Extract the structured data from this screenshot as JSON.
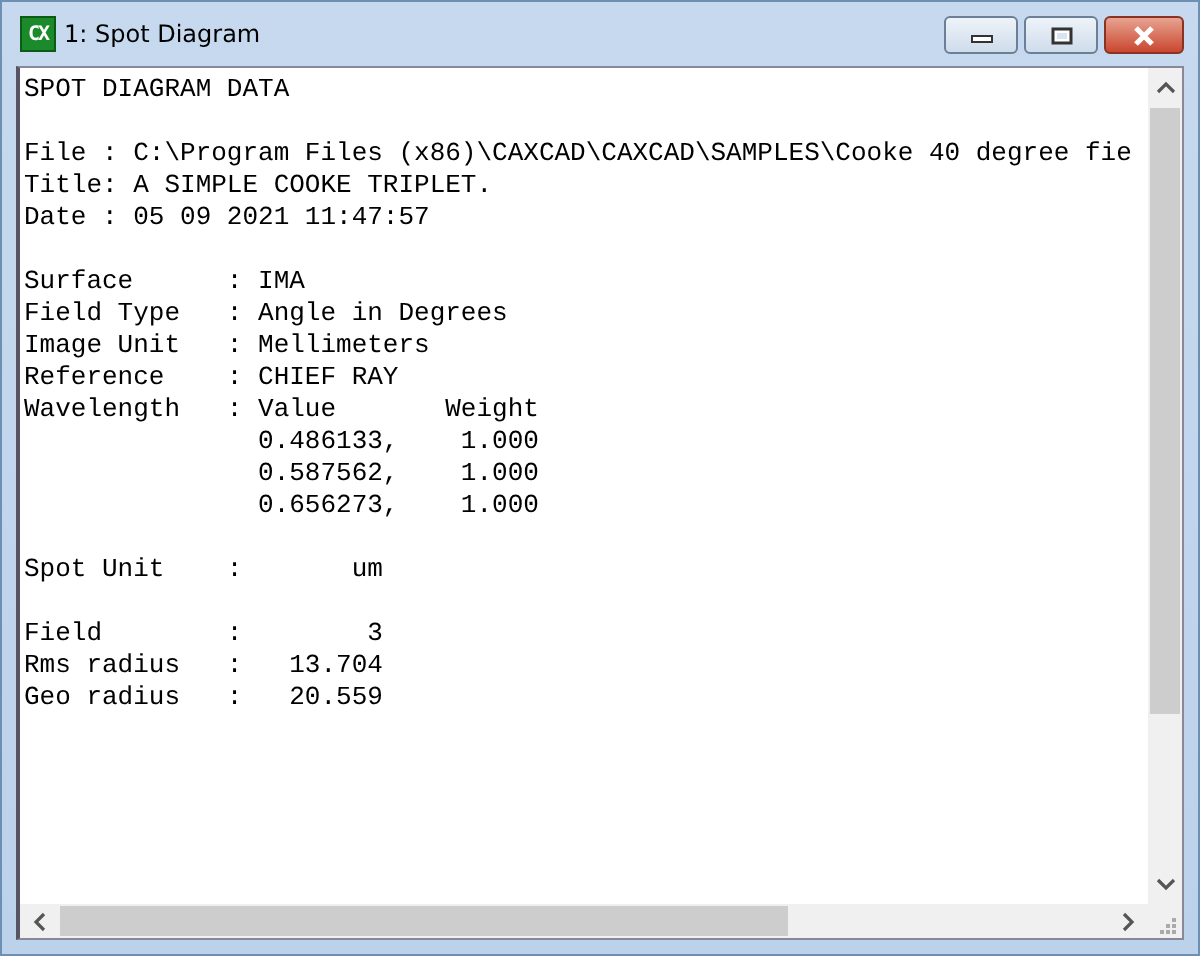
{
  "window": {
    "title": "1: Spot Diagram",
    "icon_text": "CX"
  },
  "text_blocks": [
    [
      "SPOT DIAGRAM DATA"
    ],
    [
      "File : C:\\Program Files (x86)\\CAXCAD\\CAXCAD\\SAMPLES\\Cooke 40 degree fie",
      "Title: A SIMPLE COOKE TRIPLET.",
      "Date : 05 09 2021 11:47:57"
    ],
    [
      "Surface      : IMA",
      "Field Type   : Angle in Degrees",
      "Image Unit   : Mellimeters",
      "Reference    : CHIEF RAY",
      "Wavelength   : Value       Weight",
      "               0.486133,    1.000",
      "               0.587562,    1.000",
      "               0.656273,    1.000"
    ],
    [
      "Spot Unit    :       um"
    ],
    [
      "Field        :        3",
      "Rms radius   :   13.704",
      "Geo radius   :   20.559"
    ]
  ]
}
